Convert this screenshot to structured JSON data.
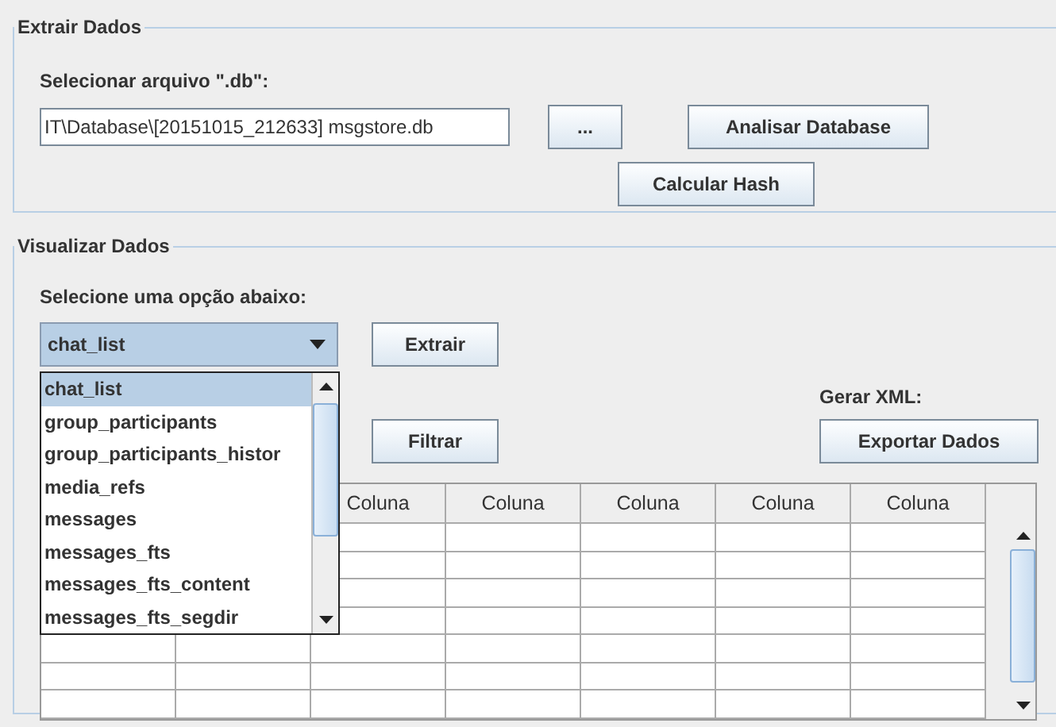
{
  "extract_panel": {
    "title": "Extrair Dados",
    "file_label": "Selecionar arquivo \".db\":",
    "file_path": "IT\\Database\\[20151015_212633] msgstore.db",
    "browse_button": "...",
    "analyze_button": "Analisar Database",
    "hash_button": "Calcular Hash"
  },
  "view_panel": {
    "title": "Visualizar Dados",
    "option_label": "Selecione uma opção abaixo:",
    "combo_value": "chat_list",
    "combo_open": true,
    "options": [
      {
        "label": "chat_list",
        "selected": true
      },
      {
        "label": "group_participants",
        "selected": false
      },
      {
        "label": "group_participants_histor",
        "selected": false
      },
      {
        "label": "media_refs",
        "selected": false
      },
      {
        "label": "messages",
        "selected": false
      },
      {
        "label": "messages_fts",
        "selected": false
      },
      {
        "label": "messages_fts_content",
        "selected": false
      },
      {
        "label": "messages_fts_segdir",
        "selected": false
      }
    ],
    "extract_button": "Extrair",
    "filter_button": "Filtrar",
    "xml_label": "Gerar XML:",
    "export_button": "Exportar Dados",
    "table": {
      "columns": [
        "Coluna",
        "Coluna",
        "Coluna",
        "Coluna",
        "Coluna"
      ]
    }
  }
}
